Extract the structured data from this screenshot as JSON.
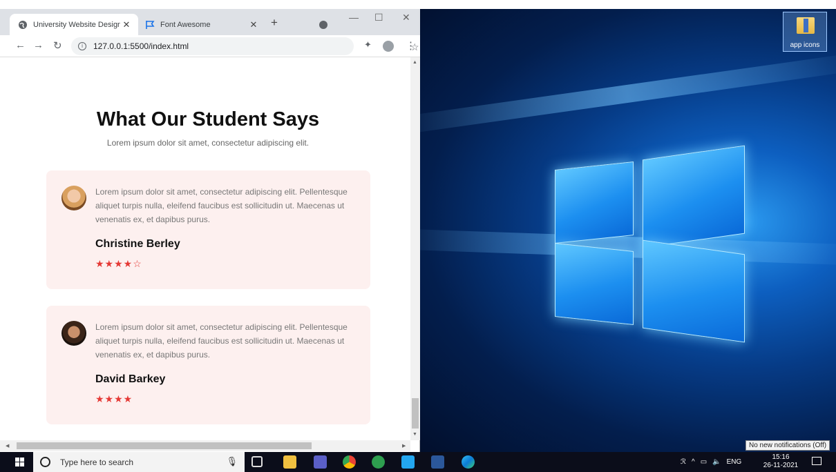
{
  "browser": {
    "tabs": [
      {
        "title": "University Website Design",
        "active": true
      },
      {
        "title": "Font Awesome",
        "active": false
      }
    ],
    "url": "127.0.0.1:5500/index.html"
  },
  "page": {
    "title": "What Our Student Says",
    "subtitle": "Lorem ipsum dolor sit amet, consectetur adipiscing elit.",
    "testimonials": [
      {
        "text": "Lorem ipsum dolor sit amet, consectetur adipiscing elit. Pellentesque aliquet turpis nulla, eleifend faucibus est sollicitudin ut. Maecenas ut venenatis ex, et dapibus purus.",
        "name": "Christine Berley",
        "stars": "★★★★☆",
        "rating": 4
      },
      {
        "text": "Lorem ipsum dolor sit amet, consectetur adipiscing elit. Pellentesque aliquet turpis nulla, eleifend faucibus est sollicitudin ut. Maecenas ut venenatis ex, et dapibus purus.",
        "name": "David Barkey",
        "stars": "★★★★",
        "rating": 4
      }
    ]
  },
  "desktop": {
    "icon_label": "app icons",
    "notification_tooltip": "No new notifications (Off)"
  },
  "taskbar": {
    "search_placeholder": "Type here to search",
    "language": "ENG",
    "time": "15:16",
    "date": "26-11-2021"
  },
  "colors": {
    "accent_star": "#e53935",
    "card_background": "#fdf0ef",
    "taskbar": "#0b0d1a"
  }
}
